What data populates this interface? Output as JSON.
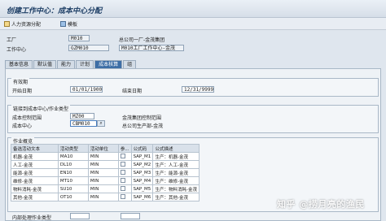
{
  "window": {
    "title": "创建工作中心：成本中心分配"
  },
  "toolbar": {
    "capacity_btn": "人力资源分配",
    "template_btn": "模板"
  },
  "header": {
    "plant_label": "工厂",
    "plant_value": "M010",
    "plant_desc": "总公司一厂-金茂集团",
    "wc_label": "工作中心",
    "wc_value": "GZM010",
    "wc_desc": "M010工厂工作中心-金茂"
  },
  "tabs": [
    "基本信息",
    "默认值",
    "能力",
    "计划",
    "成本核算",
    "组"
  ],
  "validity": {
    "group_title": "有效期",
    "start_label": "开始日期",
    "start_value": "01/01/1900",
    "end_label": "结束日期",
    "end_value": "12/31/9999"
  },
  "link": {
    "group_title": "链接到成本中心/作业类型",
    "ctrl_area_label": "成本控制范围",
    "ctrl_area_value": "MZ00",
    "ctrl_area_desc": "金茂集团控制范围",
    "cc_label": "成本中心",
    "cc_value": "CBM010",
    "cc_desc": "总公司生产部-金茂"
  },
  "activities": {
    "group_title": "作业概览",
    "headers": [
      "备选活动文本",
      "活动类型",
      "活动单位",
      "参...",
      "公式码",
      "公式描述"
    ],
    "rows": [
      {
        "text": "机器-金茂",
        "type": "MA10",
        "unit": "MIN",
        "ref": "",
        "code": "SAP_M1",
        "desc": "生产：机器-金茂"
      },
      {
        "text": "人工-金茂",
        "type": "DL10",
        "unit": "MIN",
        "ref": "",
        "code": "SAP_M2",
        "desc": "生产：人工-金茂"
      },
      {
        "text": "能源-金茂",
        "type": "EN10",
        "unit": "MIN",
        "ref": "",
        "code": "SAP_M3",
        "desc": "生产：能源-金茂"
      },
      {
        "text": "维修-金茂",
        "type": "MT10",
        "unit": "MIN",
        "ref": "",
        "code": "SAP_M4",
        "desc": "生产：维修-金茂"
      },
      {
        "text": "物料消耗-金茂",
        "type": "SU10",
        "unit": "MIN",
        "ref": "",
        "code": "SAP_M5",
        "desc": "生产：物料消耗-金茂"
      },
      {
        "text": "其他-金茂",
        "type": "OT10",
        "unit": "MIN",
        "ref": "",
        "code": "SAP_M6",
        "desc": "生产：其他-金茂"
      }
    ]
  },
  "footer": {
    "internal_label": "内部处理作业类型"
  },
  "watermark": "知乎 @捞月亮的渔民"
}
